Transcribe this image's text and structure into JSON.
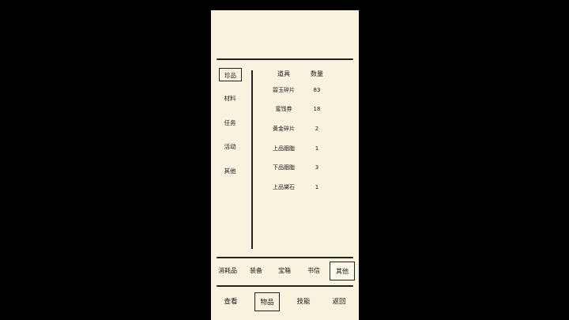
{
  "categories": [
    {
      "label": "珍品",
      "selected": true
    },
    {
      "label": "材料",
      "selected": false
    },
    {
      "label": "任务",
      "selected": false
    },
    {
      "label": "活动",
      "selected": false
    },
    {
      "label": "其他",
      "selected": false
    }
  ],
  "table": {
    "headers": {
      "item": "道具",
      "quantity": "数量"
    },
    "rows": [
      {
        "name": "碧玉碎片",
        "qty": "83"
      },
      {
        "name": "蜜饯券",
        "qty": "18"
      },
      {
        "name": "黄金碎片",
        "qty": "2"
      },
      {
        "name": "上品胭脂",
        "qty": "1"
      },
      {
        "name": "下品胭脂",
        "qty": "3"
      },
      {
        "name": "上品黛石",
        "qty": "1"
      }
    ]
  },
  "tabs": [
    {
      "label": "消耗品",
      "selected": false
    },
    {
      "label": "装备",
      "selected": false
    },
    {
      "label": "宝箱",
      "selected": false
    },
    {
      "label": "书信",
      "selected": false
    },
    {
      "label": "其他",
      "selected": true
    }
  ],
  "bottom_nav": [
    {
      "label": "查看",
      "selected": false
    },
    {
      "label": "物品",
      "selected": true
    },
    {
      "label": "技能",
      "selected": false
    },
    {
      "label": "返回",
      "selected": false
    }
  ]
}
